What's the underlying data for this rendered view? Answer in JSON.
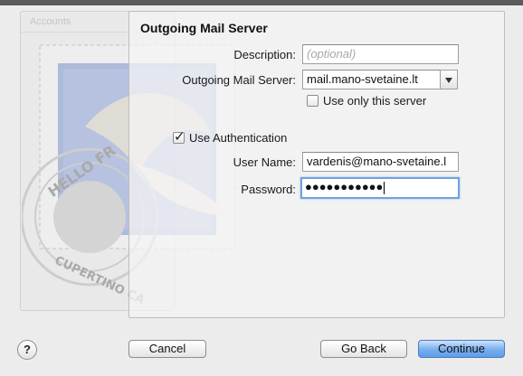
{
  "sidebar": {
    "header": "Accounts"
  },
  "stamp": {
    "text_top": "HELLO FR",
    "text_bottom": "CUPERTINO CA"
  },
  "dialog": {
    "title": "Outgoing Mail Server",
    "description": {
      "label": "Description:",
      "value": "",
      "placeholder": "(optional)"
    },
    "server": {
      "label": "Outgoing Mail Server:",
      "value": "mail.mano-svetaine.lt"
    },
    "use_only": {
      "label": "Use only this server",
      "checked": false
    },
    "use_auth": {
      "label": "Use Authentication",
      "checked": true
    },
    "username": {
      "label": "User Name:",
      "value": "vardenis@mano-svetaine.l"
    },
    "password": {
      "label": "Password:",
      "value": "●●●●●●●●●●●"
    }
  },
  "buttons": {
    "help": "?",
    "cancel": "Cancel",
    "back": "Go Back",
    "continue": "Continue"
  }
}
